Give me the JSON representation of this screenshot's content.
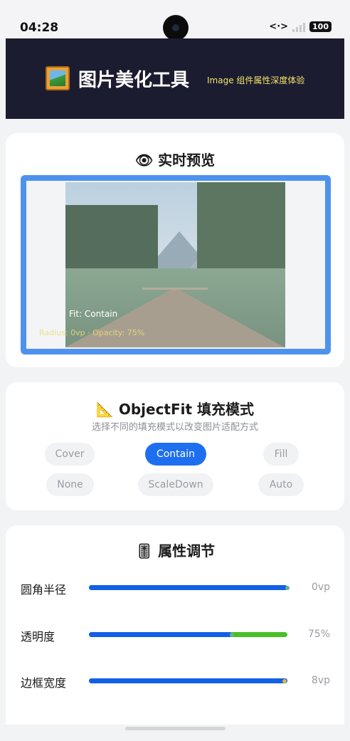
{
  "status_bar": {
    "time": "04:28",
    "icons": [
      "data-transfer-icon",
      "signal-icon",
      "battery-icon"
    ],
    "transfer_glyph": "<·>",
    "battery_level": "100"
  },
  "header": {
    "logo_icon": "framed-picture-icon",
    "title": "图片美化工具",
    "subtitle": "Image 组件属性深度体验",
    "colors": {
      "background": "#1b1c30",
      "title": "#ffffff",
      "subtitle": "#f4e36a"
    }
  },
  "preview": {
    "icon": "eye-icon",
    "icon_glyph": "👁",
    "title": "实时预览",
    "fit_caption": "Fit: Contain",
    "meta_caption": "Radius: 0vp · Opacity: 75%",
    "frame_color": "#4e92ee"
  },
  "object_fit": {
    "icon": "triangular-ruler-icon",
    "icon_glyph": "📐",
    "title": "ObjectFit 填充模式",
    "description": "选择不同的填充模式以改变图片适配方式",
    "options": [
      "Cover",
      "Contain",
      "Fill",
      "None",
      "ScaleDown",
      "Auto"
    ],
    "selected": "Contain",
    "accent": "#1e6ff0"
  },
  "properties": {
    "icon": "level-slider-icon",
    "icon_glyph": "🎚",
    "title": "属性调节",
    "sliders": [
      {
        "label": "圆角半径",
        "value_text": "0vp",
        "fill_fraction": 1.0,
        "thumb_fraction": 1.0
      },
      {
        "label": "透明度",
        "value_text": "75%",
        "fill_fraction": 0.72,
        "thumb_fraction": 0.72
      },
      {
        "label": "边框宽度",
        "value_text": "8vp",
        "fill_fraction": 1.0,
        "thumb_fraction": 0.985
      }
    ],
    "colors": {
      "fill": "#1160e6",
      "track": "#48c026"
    }
  }
}
